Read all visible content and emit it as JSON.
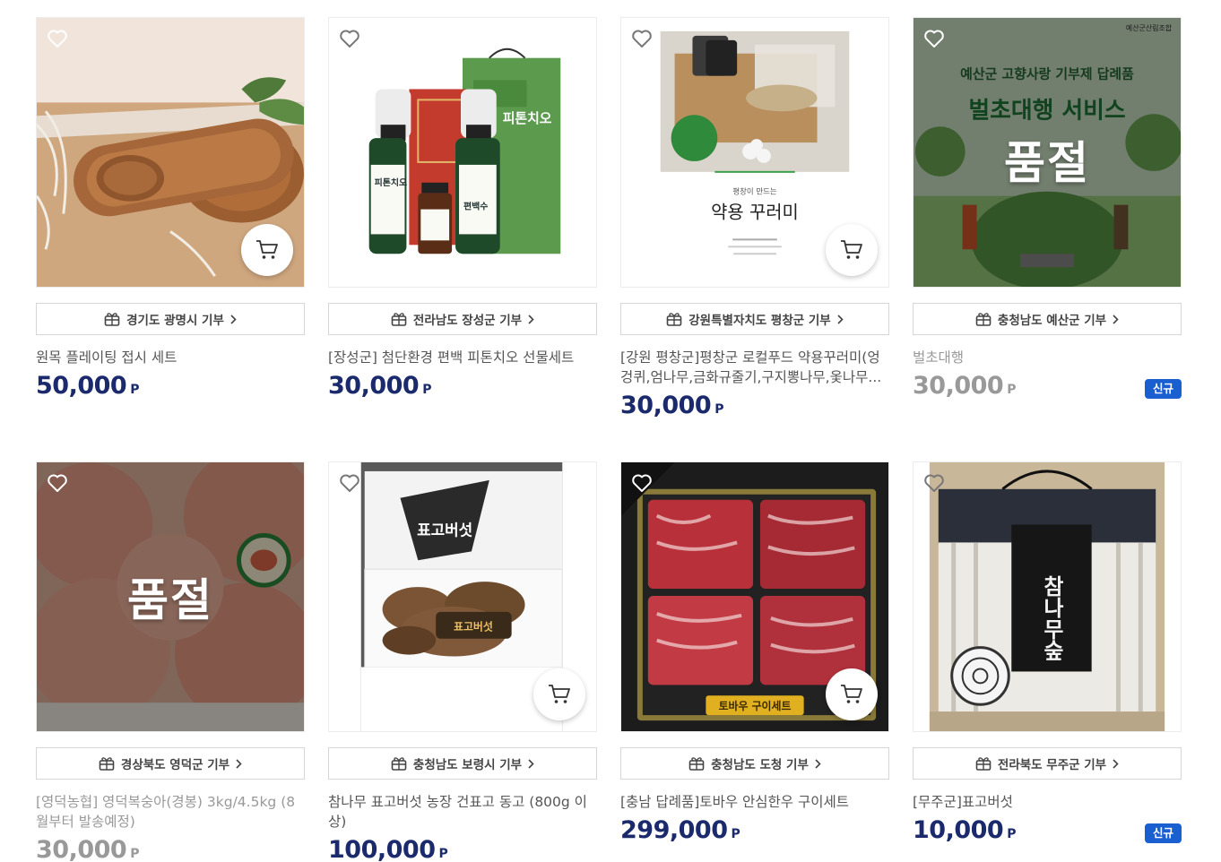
{
  "products": [
    {
      "region": "경기도 광명시 기부",
      "title": "원목 플레이팅 접시 세트",
      "price": "50,000",
      "unit": "P",
      "badge": "",
      "soldout": false
    },
    {
      "region": "전라남도 장성군 기부",
      "title": "[장성군] 첨단환경 편백 피톤치오 선물세트",
      "price": "30,000",
      "unit": "P",
      "badge": "",
      "soldout": false,
      "img_text": {
        "box_label": "피톤치오",
        "bottle_1": "피톤치오",
        "bottle_2": "편백수"
      }
    },
    {
      "region": "강원특별자치도 평창군 기부",
      "title": "[강원 평창군]평창군 로컬푸드 약용꾸러미(엉겅퀴,엄나무,금화규줄기,구지뽕나무,옻나무...",
      "price": "30,000",
      "unit": "P",
      "badge": "",
      "soldout": false,
      "img_text": {
        "headline": "약용 꾸러미",
        "sub": "평창이 만드는"
      }
    },
    {
      "region": "충청남도 예산군 기부",
      "title": "벌초대행",
      "price": "30,000",
      "unit": "P",
      "badge": "신규",
      "soldout": true,
      "soldout_label": "품절",
      "img_text": {
        "top": "예산군 고향사랑 기부제 답례품",
        "headline": "벌초대행 서비스",
        "corner": "예산군산림조합"
      }
    },
    {
      "region": "경상북도 영덕군 기부",
      "title": "[영덕농협] 영덕복숭아(경봉) 3kg/4.5kg (8월부터 발송예정)",
      "price": "30,000",
      "unit": "P",
      "badge": "",
      "soldout": true,
      "soldout_label": "품절"
    },
    {
      "region": "충청남도 보령시 기부",
      "title": "참나무 표고버섯 농장 건표고 동고 (800g 이상)",
      "price": "100,000",
      "unit": "P",
      "badge": "",
      "soldout": false,
      "img_text": {
        "headline": "표고버섯",
        "label": "표고버섯"
      }
    },
    {
      "region": "충청남도 도청 기부",
      "title": "[충남 답례품]토바우 안심한우 구이세트",
      "price": "299,000",
      "unit": "P",
      "badge": "",
      "soldout": false,
      "img_text": {
        "label": "토바우 구이세트"
      }
    },
    {
      "region": "전라북도 무주군 기부",
      "title": "[무주군]표고버섯",
      "price": "10,000",
      "unit": "P",
      "badge": "신규",
      "soldout": false,
      "img_text": {
        "headline": "참나무숲"
      }
    }
  ],
  "colors": {
    "price": "#1a2a6c",
    "badge": "#1a5fd0",
    "overlay": "rgba(0,0,0,0.45)"
  },
  "icons": {
    "wishlist": "heart-outline-icon",
    "cart": "cart-icon",
    "region": "gift-box-icon",
    "region_link": "chevron-right-icon"
  }
}
